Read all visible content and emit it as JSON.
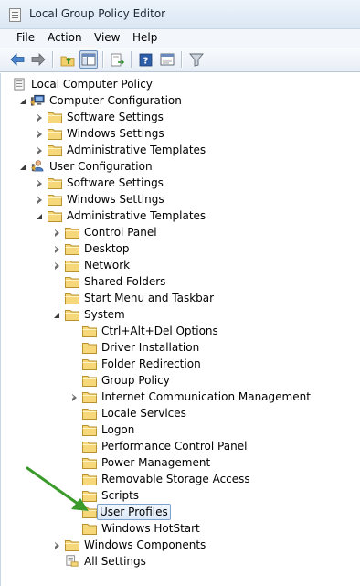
{
  "window": {
    "title": "Local Group Policy Editor"
  },
  "menu": {
    "items": [
      "File",
      "Action",
      "View",
      "Help"
    ]
  },
  "toolbar": {
    "buttons": [
      "back-icon",
      "forward-icon",
      "up-folder-icon",
      "show-hide-console-tree-icon",
      "export-list-icon",
      "help-icon",
      "properties-pane-icon",
      "filter-icon"
    ]
  },
  "tree": {
    "root": "Local Computer Policy",
    "computer": {
      "label": "Computer Configuration",
      "children": [
        "Software Settings",
        "Windows Settings",
        "Administrative Templates"
      ]
    },
    "user": {
      "label": "User Configuration",
      "software": "Software Settings",
      "windows": "Windows Settings",
      "admin": "Administrative Templates",
      "admin_children": {
        "control_panel": "Control Panel",
        "desktop": "Desktop",
        "network": "Network",
        "shared_folders": "Shared Folders",
        "start_menu": "Start Menu and Taskbar",
        "system": "System",
        "windows_components": "Windows Components",
        "all_settings": "All Settings"
      },
      "system_children": [
        "Ctrl+Alt+Del Options",
        "Driver Installation",
        "Folder Redirection",
        "Group Policy",
        "Internet Communication Management",
        "Locale Services",
        "Logon",
        "Performance Control Panel",
        "Power Management",
        "Removable Storage Access",
        "Scripts",
        "User Profiles",
        "Windows HotStart"
      ],
      "selected": "User Profiles"
    }
  },
  "annotation": {
    "arrow_color": "#3a9a2a"
  }
}
